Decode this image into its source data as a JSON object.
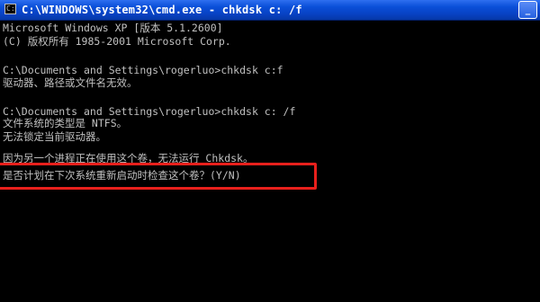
{
  "window": {
    "title": "C:\\WINDOWS\\system32\\cmd.exe - chkdsk c: /f",
    "minimize_glyph": "_",
    "app_icon": "cmd-icon"
  },
  "console": {
    "lines": [
      "Microsoft Windows XP [版本 5.1.2600]",
      "(C) 版权所有 1985-2001 Microsoft Corp.",
      "",
      "C:\\Documents and Settings\\rogerluo>chkdsk c:f",
      "驱动器、路径或文件名无效。",
      "",
      "C:\\Documents and Settings\\rogerluo>chkdsk c: /f",
      "文件系统的类型是 NTFS。",
      "无法锁定当前驱动器。",
      "",
      "因为另一个进程正在使用这个卷，无法运行 Chkdsk。",
      "是否计划在下次系统重新启动时检查这个卷？(Y/N)"
    ]
  },
  "colors": {
    "console_bg": "#000000",
    "console_text": "#c0c0c0",
    "titlebar": "#0a4fd8",
    "highlight": "#e8201c"
  }
}
